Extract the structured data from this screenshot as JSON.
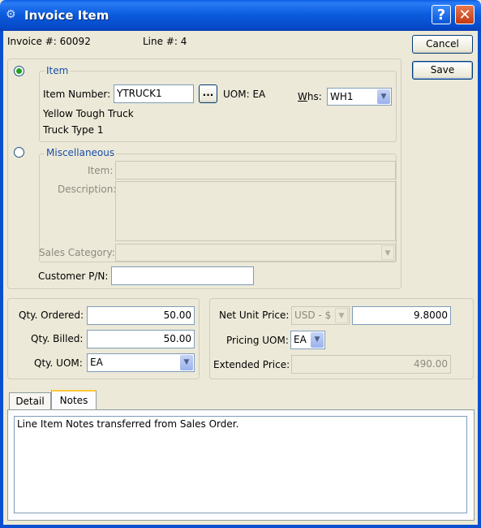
{
  "window": {
    "title": "Invoice Item",
    "help_label": "?",
    "close_label": "✕"
  },
  "header": {
    "invoice_label": "Invoice #:",
    "invoice_value": "60092",
    "line_label": "Line #:",
    "line_value": "4"
  },
  "buttons": {
    "cancel": "Cancel",
    "save": "Save"
  },
  "item_group": {
    "legend": "Item",
    "selected": true,
    "item_number_label": "Item Number:",
    "item_number_value": "YTRUCK1",
    "browse_label": "...",
    "uom_label": "UOM: EA",
    "whs_label": "Whs:",
    "whs_value": "WH1",
    "description1": "Yellow Tough Truck",
    "description2": "Truck Type 1"
  },
  "misc_group": {
    "legend": "Miscellaneous",
    "selected": false,
    "item_label": "Item:",
    "item_value": "",
    "description_label": "Description:",
    "description_value": "",
    "sales_category_label": "Sales Category:",
    "sales_category_value": ""
  },
  "customer_pn": {
    "label": "Customer P/N:",
    "value": ""
  },
  "qty": {
    "ordered_label": "Qty. Ordered:",
    "ordered_value": "50.00",
    "billed_label": "Qty. Billed:",
    "billed_value": "50.00",
    "uom_label": "Qty. UOM:",
    "uom_value": "EA"
  },
  "pricing": {
    "net_unit_price_label": "Net Unit Price:",
    "currency_value": "USD - $",
    "net_unit_price_value": "9.8000",
    "pricing_uom_label": "Pricing UOM:",
    "pricing_uom_value": "EA",
    "extended_price_label": "Extended Price:",
    "extended_price_value": "490.00"
  },
  "tabs": [
    {
      "label": "Detail",
      "active": false
    },
    {
      "label": "Notes",
      "active": true
    }
  ],
  "notes": {
    "text": "Line Item Notes transferred from Sales Order."
  },
  "colors": {
    "title_bar": "#0a5fe3",
    "window_bg": "#ece9d8",
    "group_legend": "#1a4ea8",
    "radio_selected": "#21a121",
    "tab_highlight": "#ffc83c"
  }
}
